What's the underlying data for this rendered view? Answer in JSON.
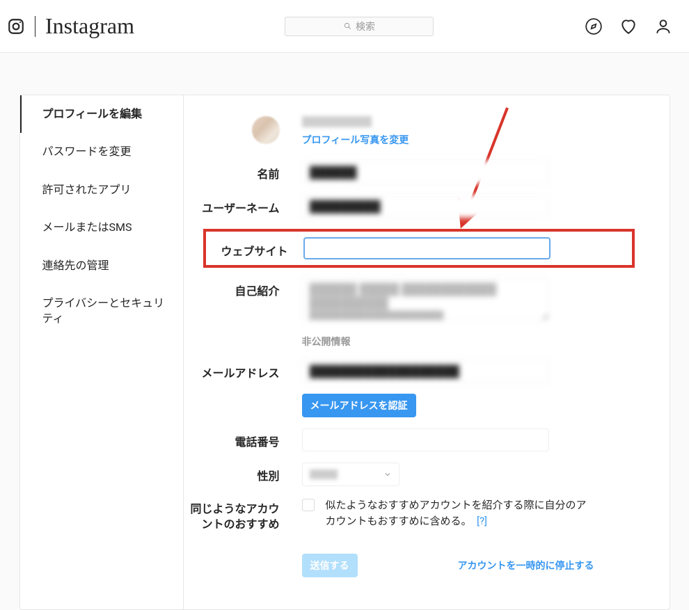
{
  "brand": "Instagram",
  "search": {
    "placeholder": "検索"
  },
  "sidebar": {
    "items": [
      "プロフィールを編集",
      "パスワードを変更",
      "許可されたアプリ",
      "メールまたはSMS",
      "連絡先の管理",
      "プライバシーとセキュリティ"
    ]
  },
  "profile": {
    "username_blur": "████████",
    "change_photo": "プロフィール写真を変更",
    "labels": {
      "name": "名前",
      "username": "ユーザーネーム",
      "website": "ウェブサイト",
      "bio": "自己紹介",
      "private_info": "非公開情報",
      "email": "メールアドレス",
      "phone": "電話番号",
      "gender": "性別",
      "similar": "同じようなアカウントのおすすめ"
    },
    "values": {
      "name": "██████",
      "username": "█████████",
      "website": "",
      "bio": "██████ █████ ████████████\n██████████\n█████████████████",
      "email": "███████████████████",
      "phone": "",
      "gender": "███"
    },
    "buttons": {
      "verify_email": "メールアドレスを認証",
      "submit": "送信する",
      "deactivate": "アカウントを一時的に停止する"
    },
    "similar_text": "似たようなおすすめアカウントを紹介する際に自分のアカウントもおすすめに含める。",
    "help": "[?]"
  }
}
